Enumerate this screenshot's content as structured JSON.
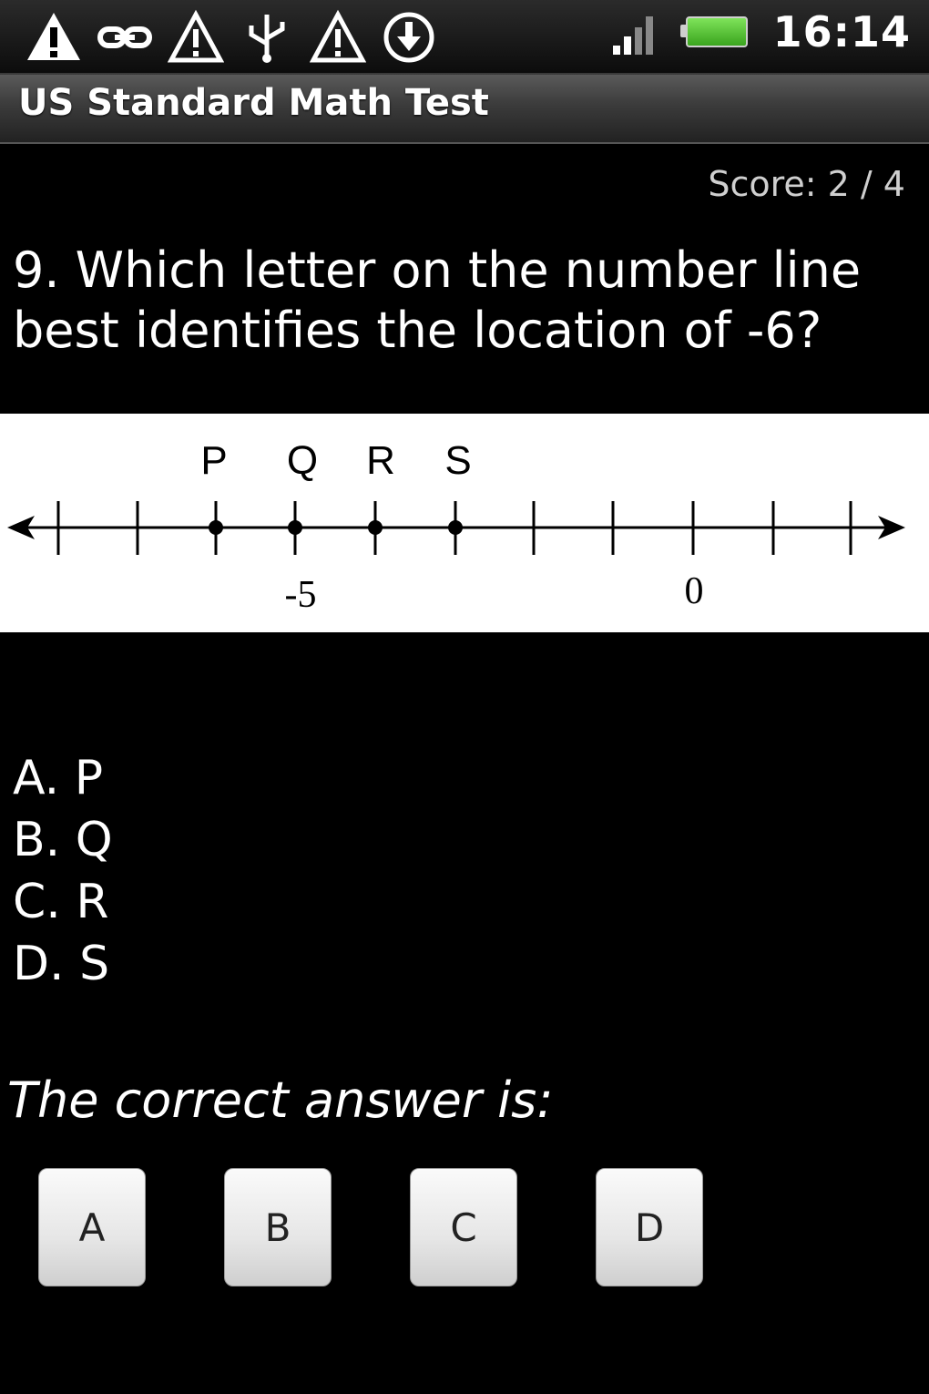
{
  "status_bar": {
    "time": "16:14",
    "icons": [
      "warning-icon",
      "link-icon",
      "alert-icon",
      "usb-icon",
      "alert-icon",
      "download-icon"
    ],
    "signal_icon": "signal-bars-icon",
    "battery_icon": "battery-icon",
    "battery_color": "#3aa51e"
  },
  "app": {
    "title": "US Standard Math Test"
  },
  "score": {
    "label": "Score: 2 / 4"
  },
  "question": {
    "text": "9. Which letter on the number line best identifies the location of -6?"
  },
  "number_line": {
    "point_labels": [
      "P",
      "Q",
      "R",
      "S"
    ],
    "tick_label_left": "-5",
    "tick_label_right": "0"
  },
  "choices": [
    {
      "letter": "A.",
      "value": "P"
    },
    {
      "letter": "B.",
      "value": "Q"
    },
    {
      "letter": "C.",
      "value": "R"
    },
    {
      "letter": "D.",
      "value": "S"
    }
  ],
  "answer_prompt": "The correct answer is:",
  "answer_buttons": [
    "A",
    "B",
    "C",
    "D"
  ]
}
